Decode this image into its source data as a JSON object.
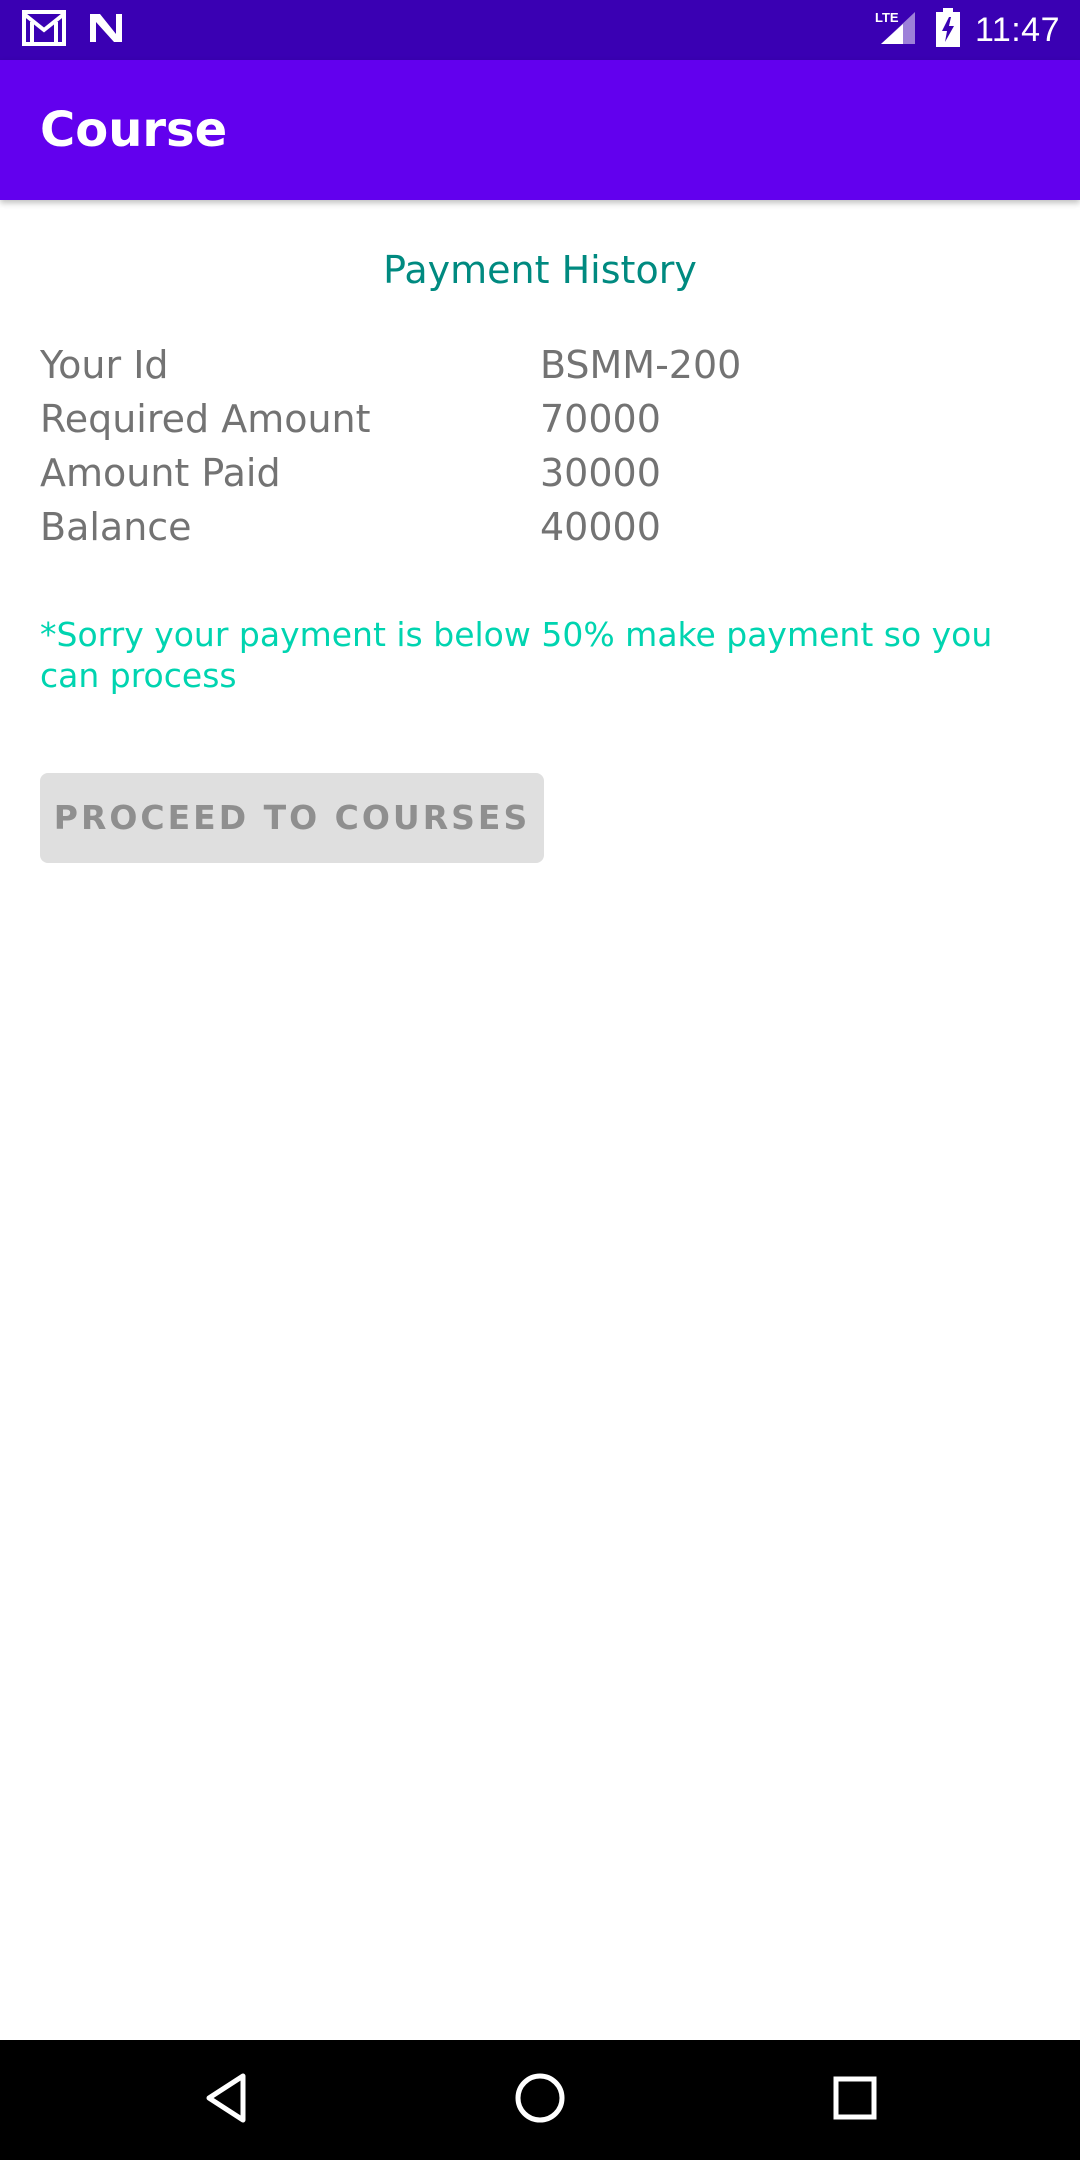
{
  "status_bar": {
    "time": "11:47",
    "icons_left": [
      "gmail-icon",
      "notification-n-icon"
    ],
    "icons_right": [
      "lte-signal-icon",
      "battery-charging-icon"
    ],
    "signal_label": "LTE",
    "background": "#3a00b3"
  },
  "app_bar": {
    "title": "Course",
    "background": "#6200ee"
  },
  "main": {
    "section_title": "Payment History",
    "rows": [
      {
        "label": "Your Id",
        "value": "BSMM-200"
      },
      {
        "label": "Required Amount",
        "value": "70000"
      },
      {
        "label": "Amount Paid",
        "value": "30000"
      },
      {
        "label": "Balance",
        "value": "40000"
      }
    ],
    "warning": "*Sorry your payment is below 50% make payment so you can process",
    "proceed_button_label": "PROCEED TO COURSES"
  },
  "nav_bar": {
    "buttons": [
      "back-icon",
      "home-icon",
      "recents-icon"
    ]
  },
  "colors": {
    "accent_teal": "#008a80",
    "warning_teal": "#00d4b0",
    "text_gray": "#737373",
    "button_disabled_bg": "#dfdfdf"
  }
}
